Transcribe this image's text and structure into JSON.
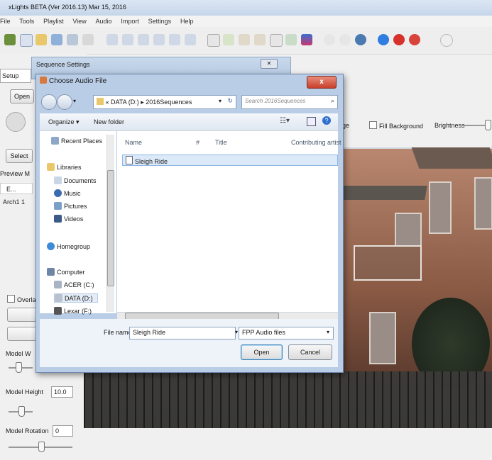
{
  "app": {
    "title": "xLights BETA (Ver 2016.13) Mar 15, 2016",
    "menu": [
      "File",
      "Tools",
      "Playlist",
      "View",
      "Audio",
      "Import",
      "Settings",
      "Help"
    ]
  },
  "left_panel": {
    "setup_tab": "Setup",
    "open_button": "Open",
    "select_button": "Select",
    "preview_label": "Preview M",
    "list_col": "E...",
    "list_row": "Arch1  1",
    "overlap_label": "Overlap",
    "model_width_label": "Model W",
    "model_height_label": "Model Height",
    "model_height_value": "10.0",
    "model_rotation_label": "Model Rotation",
    "model_rotation_value": "0"
  },
  "right_controls": {
    "image_label": "ge",
    "fill_background": "Fill Background",
    "brightness": "Brightness"
  },
  "sequence_settings": {
    "title": "Sequence Settings"
  },
  "dialog": {
    "title": "Choose Audio File",
    "close_label": "x",
    "address": [
      "«",
      "DATA (D:)",
      "▸",
      "2016Sequences"
    ],
    "search_placeholder": "Search 2016Sequences",
    "organize": "Organize ▾",
    "new_folder": "New folder",
    "nav_items": [
      {
        "label": "Recent Places"
      },
      {
        "label": "Libraries"
      },
      {
        "label": "Documents"
      },
      {
        "label": "Music"
      },
      {
        "label": "Pictures"
      },
      {
        "label": "Videos"
      },
      {
        "label": "Homegroup"
      },
      {
        "label": "Computer"
      },
      {
        "label": "ACER (C:)"
      },
      {
        "label": "DATA (D:)"
      },
      {
        "label": "Lexar (F:)"
      }
    ],
    "columns": [
      "Name",
      "#",
      "Title",
      "Contributing artist"
    ],
    "files": [
      {
        "name": "Sleigh Ride"
      }
    ],
    "filename_label": "File name:",
    "filename_value": "Sleigh Ride",
    "filetype_value": "FPP Audio files",
    "open_button": "Open",
    "cancel_button": "Cancel"
  },
  "colors": {
    "dialog_frame": "#b9cde6",
    "selection": "#dbe9f9",
    "close_red": "#c7402a"
  }
}
